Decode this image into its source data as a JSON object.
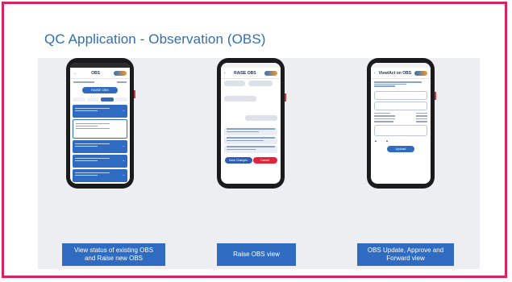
{
  "slide": {
    "title": "QC Application - Observation (OBS)",
    "accent_color": "#2e6fb3",
    "frame_color": "#d8245e"
  },
  "captions": [
    "View status of existing OBS\nand Raise new OBS",
    "Raise OBS view",
    "OBS Update, Approve and\nForward view"
  ],
  "phone1": {
    "header_title": "OBS",
    "raise_button": "RAISE OBS"
  },
  "phone2": {
    "header_title": "RAISE OBS",
    "btn_save": "Save Changes",
    "btn_cancel": "Cancel"
  },
  "phone3": {
    "header_title": "View/Act on OBS",
    "upload_button": "Upload"
  }
}
